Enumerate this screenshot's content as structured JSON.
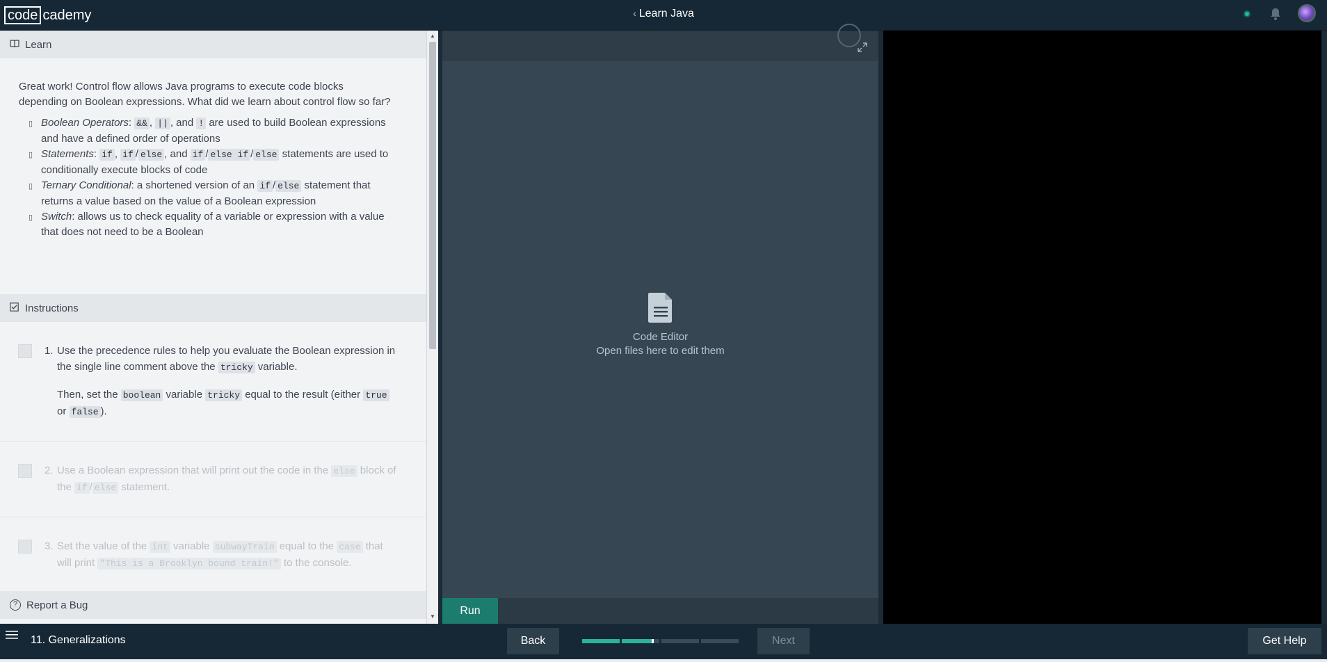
{
  "header": {
    "logo_code": "code",
    "logo_rest": "cademy",
    "course_title": "Learn Java",
    "status_dot_color": "#25b8a0"
  },
  "learn": {
    "header": "Learn",
    "intro": "Great work! Control flow allows Java programs to execute code blocks depending on Boolean expressions. What did we learn about control flow so far?",
    "bullets": [
      {
        "term": "Boolean Operators",
        "segments": [
          "&&",
          "||",
          "!"
        ],
        "text": "are used to build Boolean expressions and have a defined order of operations"
      },
      {
        "term": "Statements",
        "text": "statements are used to conditionally execute blocks of code"
      },
      {
        "term": "Ternary Conditional",
        "text": "a shortened version of an",
        "text2": "statement that returns a value based on the value of a Boolean expression"
      },
      {
        "term": "Switch",
        "text": "allows us to check equality of a variable or expression with a value that does not need to be a Boolean"
      }
    ]
  },
  "instructions": {
    "header": "Instructions",
    "steps": [
      {
        "num": "1.",
        "line1_a": "Use the precedence rules to help you evaluate the Boolean expression in the single line comment above the",
        "line1_code": "tricky",
        "line1_b": "variable.",
        "line2_a": "Then, set the",
        "line2_code1": "boolean",
        "line2_b": "variable",
        "line2_code2": "tricky",
        "line2_c": "equal to the result (either",
        "line2_code3": "true",
        "line2_d": "or",
        "line2_code4": "false",
        "line2_e": ")."
      },
      {
        "num": "2.",
        "a": "Use a Boolean expression that will print out the code in the",
        "code1": "else",
        "b": "block of the",
        "code2": "if",
        "code3": "else",
        "c": "statement."
      },
      {
        "num": "3.",
        "a": "Set the value of the",
        "code1": "int",
        "b": "variable",
        "code2": "subwayTrain",
        "c": "equal to the",
        "code3": "case",
        "d": "that will print",
        "code4": "\"This is a Brooklyn bound train!\"",
        "e": "to the console."
      }
    ]
  },
  "report_bug": "Report a Bug",
  "editor": {
    "placeholder_title": "Code Editor",
    "placeholder_sub": "Open files here to edit them",
    "run_label": "Run"
  },
  "footer": {
    "lesson_label": "11. Generalizations",
    "back_label": "Back",
    "next_label": "Next",
    "get_help_label": "Get Help",
    "progress_segments": [
      "complete",
      "current",
      "incomplete",
      "incomplete"
    ]
  },
  "colors": {
    "accent": "#1c7d6e",
    "progress": "#2ab39a"
  }
}
